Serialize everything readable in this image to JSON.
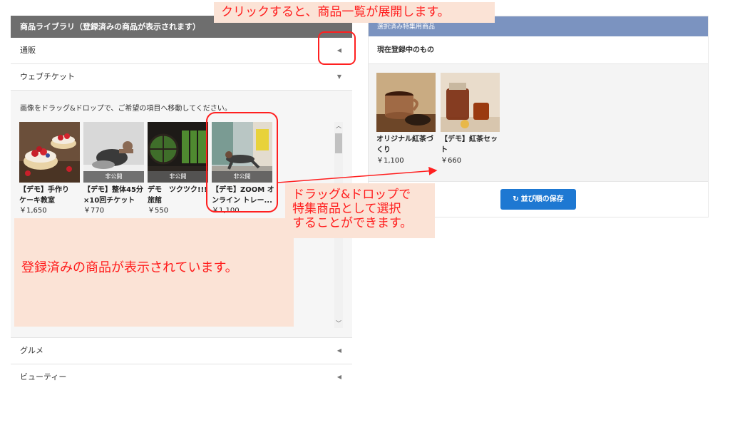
{
  "library": {
    "header": "商品ライブラリ（登録済みの商品が表示されます）",
    "categories": [
      {
        "label": "通販",
        "arrow": "◀"
      },
      {
        "label": "ウェブチケット",
        "arrow": "▼"
      },
      {
        "label": "グルメ",
        "arrow": "◀"
      },
      {
        "label": "ビューティー",
        "arrow": "◀"
      }
    ],
    "instruction": "画像をドラッグ&ドロップで、ご希望の項目へ移動してください。",
    "products": [
      {
        "name_line1": "【デモ】手作り",
        "name_line2": "ケーキ教室",
        "price": "￥1,650",
        "badge": ""
      },
      {
        "name_line1": "【デモ】整体45分",
        "name_line2": "×10回チケット",
        "price": "￥770",
        "badge": "非公開"
      },
      {
        "name_line1": "デモ　ツクツク!!!",
        "name_line2": "旅館",
        "price": "￥550",
        "badge": "非公開"
      },
      {
        "name_line1": "【デモ】ZOOM オ",
        "name_line2": "ンライン トレー...",
        "price": "￥1,100",
        "badge": "非公開"
      }
    ]
  },
  "selected": {
    "header": "選択済み特集用商品",
    "subheader": "現在登録中のもの",
    "items": [
      {
        "name_line1": "オリジナル紅茶づ",
        "name_line2": "くり",
        "price": "￥1,100"
      },
      {
        "name_line1": "【デモ】紅茶セッ",
        "name_line2": "ト",
        "price": "￥660"
      }
    ],
    "save_label": "並び順の保存",
    "save_icon": "↻"
  },
  "callouts": {
    "top": "クリックすると、商品一覧が展開します。",
    "dragdrop": "ドラッグ&ドロップで\n特集商品として選択\nすることができます。",
    "registered": "登録済みの商品が表示されています。"
  },
  "colors": {
    "accent": "#1e78d2",
    "callout_text": "#ff1c1c",
    "callout_bg": "#fbe3d6",
    "header_left": "#6e6e6e",
    "header_right": "#7b93c0"
  }
}
